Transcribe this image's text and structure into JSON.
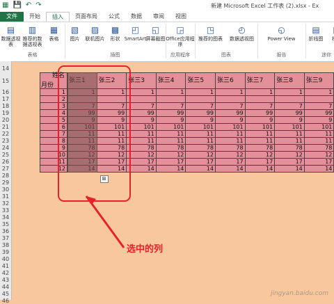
{
  "window": {
    "title": "新建 Microsoft Excel 工作表 (2).xlsx - Ex"
  },
  "tabs": [
    "文件",
    "开始",
    "插入",
    "页面布局",
    "公式",
    "数据",
    "审阅",
    "视图"
  ],
  "active_tab": "插入",
  "ribbon": {
    "groups": [
      {
        "name": "表格",
        "buttons": [
          "数据透视表",
          "推荐的数据透视表",
          "表格"
        ]
      },
      {
        "name": "插图",
        "buttons": [
          "图片",
          "联机图片",
          "形状",
          "SmartArt",
          "屏幕截图"
        ]
      },
      {
        "name": "应用程序",
        "buttons": [
          "Office应用程序"
        ]
      },
      {
        "name": "图表",
        "buttons": [
          "推荐的图表",
          "数据透视图"
        ]
      },
      {
        "name": "报告",
        "buttons": [
          "Power View"
        ]
      },
      {
        "name": "迷你",
        "buttons": [
          "折线图",
          "柱形"
        ]
      }
    ]
  },
  "row_numbers": [
    "14",
    "15",
    "16",
    "17",
    "18",
    "19",
    "20",
    "21",
    "22",
    "23",
    "24",
    "25",
    "26",
    "27",
    "28",
    "29",
    "30",
    "31",
    "32",
    "33",
    "34",
    "35",
    "36",
    "37",
    "38",
    "39",
    "40",
    "41",
    "42",
    "43",
    "44",
    "45",
    "46"
  ],
  "table": {
    "corner_top": "姓名",
    "corner_bottom": "月份",
    "names": [
      "张三1",
      "张三2",
      "张三3",
      "张三4",
      "张三5",
      "张三6",
      "张三7",
      "张三8",
      "张三9"
    ],
    "months": [
      "1",
      "2",
      "3",
      "4",
      "5",
      "6",
      "7",
      "8",
      "9",
      "10",
      "11",
      "12"
    ],
    "values": [
      "1",
      "",
      "7",
      "99",
      "9",
      "101",
      "11",
      "11",
      "78",
      "12",
      "17",
      "14"
    ]
  },
  "annotation": "选中的列",
  "watermark": "jingyan.baidu.com",
  "colors": {
    "sheet_bg": "#f8c79e",
    "table_bg": "#e3909a",
    "accent": "#217346",
    "annot": "#e8202a"
  }
}
